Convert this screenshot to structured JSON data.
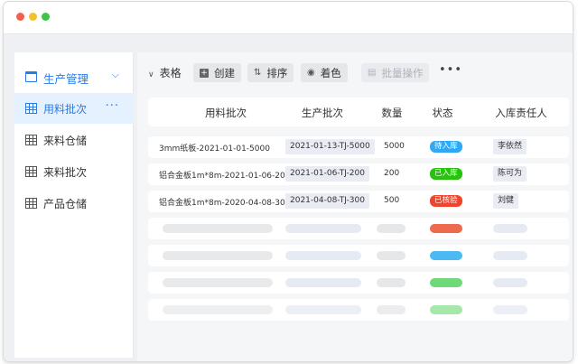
{
  "window": {
    "controls": [
      "close",
      "minimize",
      "maximize"
    ]
  },
  "sidebar": {
    "group": {
      "label": "生产管理",
      "icon": "calendar-icon",
      "chevron": "chevron-down-icon"
    },
    "items": [
      {
        "label": "用料批次",
        "icon": "table-icon",
        "active": true,
        "more": "···"
      },
      {
        "label": "来料仓储",
        "icon": "table-icon",
        "active": false
      },
      {
        "label": "来料批次",
        "icon": "table-icon",
        "active": false
      },
      {
        "label": "产品仓储",
        "icon": "table-icon",
        "active": false
      }
    ]
  },
  "toolbar": {
    "title": "表格",
    "create_label": "创建",
    "sort_label": "排序",
    "color_label": "着色",
    "batch_label": "批量操作",
    "more": "•••"
  },
  "table": {
    "headers": [
      "用料批次",
      "生产批次",
      "数量",
      "状态",
      "入库责任人"
    ],
    "rows": [
      {
        "material_batch": "3mm纸板-2021-01-01-5000",
        "production_batch": "2021-01-13-TJ-5000",
        "quantity": "5000",
        "status": "待入库",
        "status_color": "#2fa9f5",
        "owner": "李依然"
      },
      {
        "material_batch": "铝合金板1m*8m-2021-01-06-200",
        "production_batch": "2021-01-06-TJ-200",
        "quantity": "200",
        "status": "已入库",
        "status_color": "#27c20e",
        "owner": "陈可为"
      },
      {
        "material_batch": "铝合金板1m*8m-2020-04-08-300",
        "production_batch": "2021-04-08-TJ-300",
        "quantity": "500",
        "status": "已核验",
        "status_color": "#f0442c",
        "owner": "刘健"
      }
    ],
    "placeholder_status_colors": [
      "#ee6a4f",
      "#4db9f3",
      "#6fd97a",
      "#a6e8a9"
    ]
  },
  "colors": {
    "accent": "#2a7be4",
    "active_bg": "#e6f1ff"
  }
}
